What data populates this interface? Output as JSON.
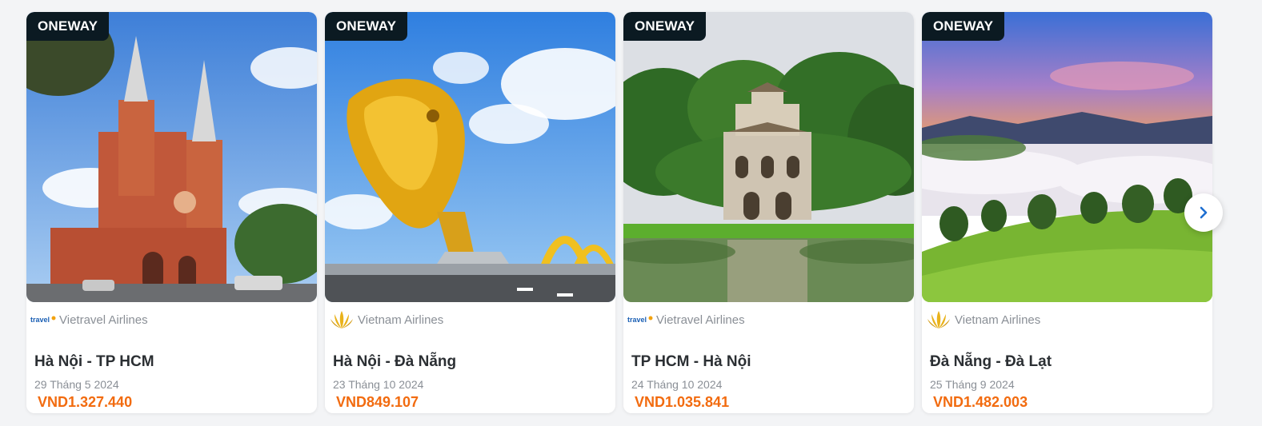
{
  "cards": [
    {
      "badge": "ONEWAY",
      "airline": "Vietravel Airlines",
      "airline_icon": "vietravel-logo-icon",
      "route": "Hà Nội - TP HCM",
      "date": "29 Tháng 5 2024",
      "price": "VND1.327.440",
      "photo_subject": "cathedral"
    },
    {
      "badge": "ONEWAY",
      "airline": "Vietnam Airlines",
      "airline_icon": "lotus-logo-icon",
      "route": "Hà Nội - Đà Nẵng",
      "date": "23 Tháng 10 2024",
      "price": "VND849.107",
      "photo_subject": "dragon-bridge"
    },
    {
      "badge": "ONEWAY",
      "airline": "Vietravel Airlines",
      "airline_icon": "vietravel-logo-icon",
      "route": "TP HCM - Hà Nội",
      "date": "24 Tháng 10 2024",
      "price": "VND1.035.841",
      "photo_subject": "turtle-tower"
    },
    {
      "badge": "ONEWAY",
      "airline": "Vietnam Airlines",
      "airline_icon": "lotus-logo-icon",
      "route": "Đà Nẵng - Đà Lạt",
      "date": "25 Tháng 9 2024",
      "price": "VND1.482.003",
      "photo_subject": "misty-hills"
    }
  ],
  "nav": {
    "next_icon": "chevron-right-icon"
  },
  "colors": {
    "price": "#f26b0f",
    "badge_bg": "#0b1a22",
    "nav_chevron": "#1f6fd1",
    "lotus_gold": "#e9b21b"
  }
}
